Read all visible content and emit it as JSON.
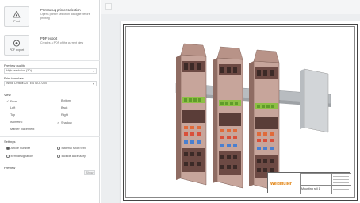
{
  "panel": {
    "print_action": {
      "button_label": "Print",
      "title": "Print setup printer selection",
      "description": "Opens printer selection dialogue before printing"
    },
    "pdf_action": {
      "button_label": "PDF export",
      "title": "PDF export",
      "description": "Creates a PDF of the current view"
    },
    "preview_quality": {
      "label": "Preview quality",
      "value": "High resolution (3D)"
    },
    "print_template": {
      "label": "Print template",
      "value": "Weid. Default A4 · EN ISO 7200"
    },
    "view": {
      "label": "View",
      "options": [
        {
          "label": "Front",
          "checked": true
        },
        {
          "label": "Bottom",
          "checked": false
        },
        {
          "label": "Left",
          "checked": false
        },
        {
          "label": "Back",
          "checked": false
        },
        {
          "label": "Top",
          "checked": false
        },
        {
          "label": "Right",
          "checked": false
        },
        {
          "label": "Isometric",
          "checked": false
        },
        {
          "label": "Shadow",
          "checked": true
        },
        {
          "label": "Marker placement",
          "checked": false
        }
      ]
    },
    "settings": {
      "label": "Settings",
      "options": [
        {
          "label": "Article number",
          "selected": true
        },
        {
          "label": "Material short text",
          "selected": false
        },
        {
          "label": "Item designation",
          "selected": false
        },
        {
          "label": "Include accessory",
          "selected": false
        }
      ]
    },
    "preview": {
      "label": "Preview",
      "button_label": "Show"
    }
  },
  "canvas": {
    "title_block": {
      "logo": "Weidmüller",
      "drawing_name": "Mounting rail 1"
    }
  },
  "colors": {
    "brand_orange": "#e07b00",
    "terminal_body": "#c7a59b",
    "terminal_dark": "#6d4a44",
    "rail": "#b8bcc0"
  },
  "icons": {
    "print": "print-icon",
    "pdf": "pdf-icon"
  }
}
